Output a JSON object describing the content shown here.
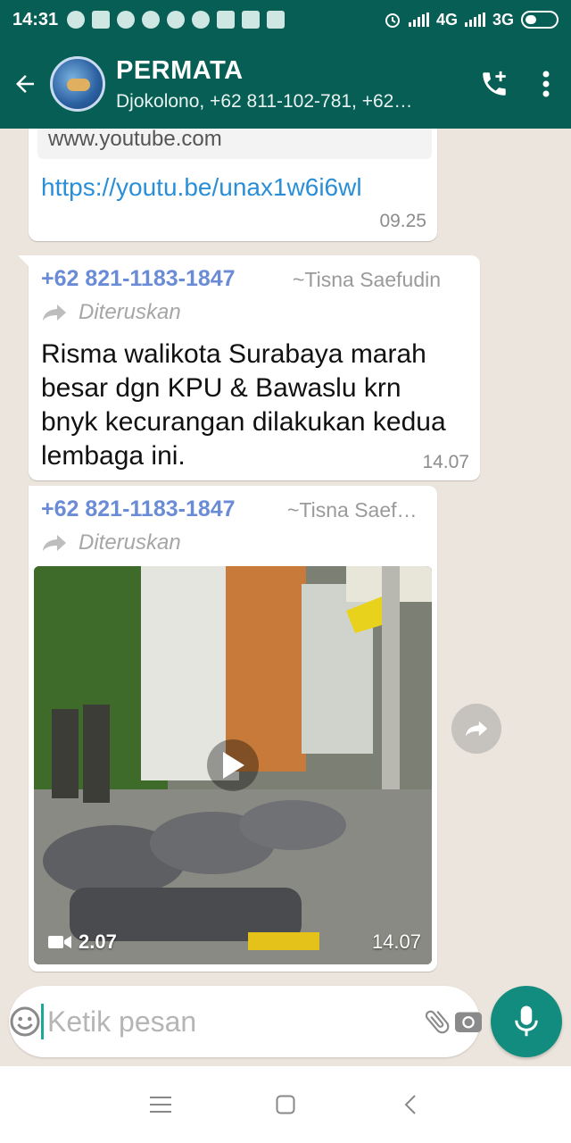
{
  "status_bar": {
    "time": "14:31",
    "network_1": "4G",
    "network_2": "3G"
  },
  "header": {
    "title": "PERMATA",
    "subtitle": "Djokolono, +62 811-102-781, +62…"
  },
  "messages": [
    {
      "link_preview_domain": "www.youtube.com",
      "link": "https://youtu.be/unax1w6i6wl",
      "time": "09.25"
    },
    {
      "sender_phone": "+62 821-1183-1847",
      "sender_name": "~Tisna Saefudin",
      "forwarded_label": "Diteruskan",
      "text": "Risma walikota Surabaya marah besar dgn KPU & Bawaslu krn bnyk kecurangan dilakukan kedua lembaga ini.",
      "time": "14.07"
    },
    {
      "sender_phone": "+62 821-1183-1847",
      "sender_name": "~Tisna Saef…",
      "forwarded_label": "Diteruskan",
      "video_duration": "2.07",
      "time": "14.07"
    }
  ],
  "composer": {
    "placeholder": "Ketik pesan"
  },
  "colors": {
    "header": "#075e54",
    "accent": "#128c7e",
    "sender": "#6a8bd6",
    "link": "#2a8fd6"
  }
}
